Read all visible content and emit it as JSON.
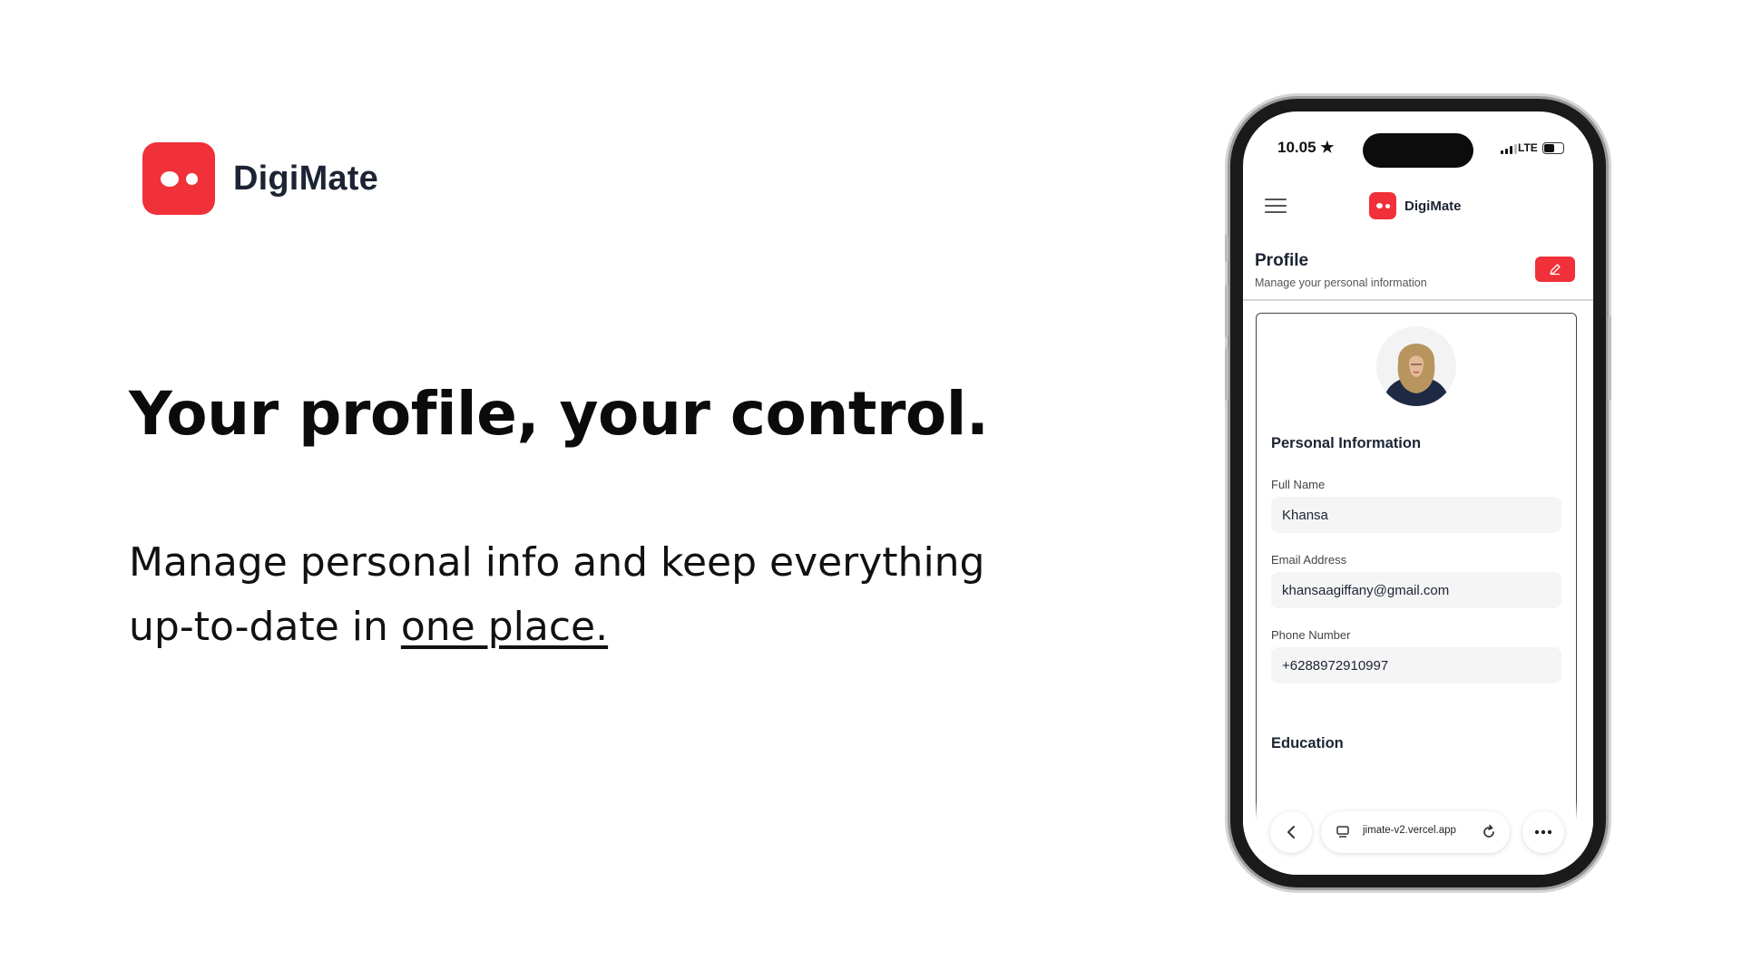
{
  "brand": {
    "name": "DigiMate",
    "color": "#f0313a"
  },
  "headline": "Your profile, your control.",
  "subtext": {
    "before_link": "Manage personal info and keep everything up-to-date in ",
    "link": "one place."
  },
  "phone": {
    "status": {
      "time": "10.05",
      "network": "LTE"
    },
    "app_name": "DigiMate",
    "menu_icon": "hamburger-icon",
    "profile": {
      "title": "Profile",
      "subtitle": "Manage your personal information",
      "edit_icon": "pencil-icon"
    },
    "personal_info": {
      "title": "Personal Information",
      "fields": [
        {
          "label": "Full Name",
          "value": "Khansa"
        },
        {
          "label": "Email Address",
          "value": "khansaagiffany@gmail.com"
        },
        {
          "label": "Phone Number",
          "value": "+6288972910997"
        }
      ]
    },
    "education": {
      "title": "Education"
    },
    "browser": {
      "url": "jimate-v2.vercel.app"
    }
  }
}
